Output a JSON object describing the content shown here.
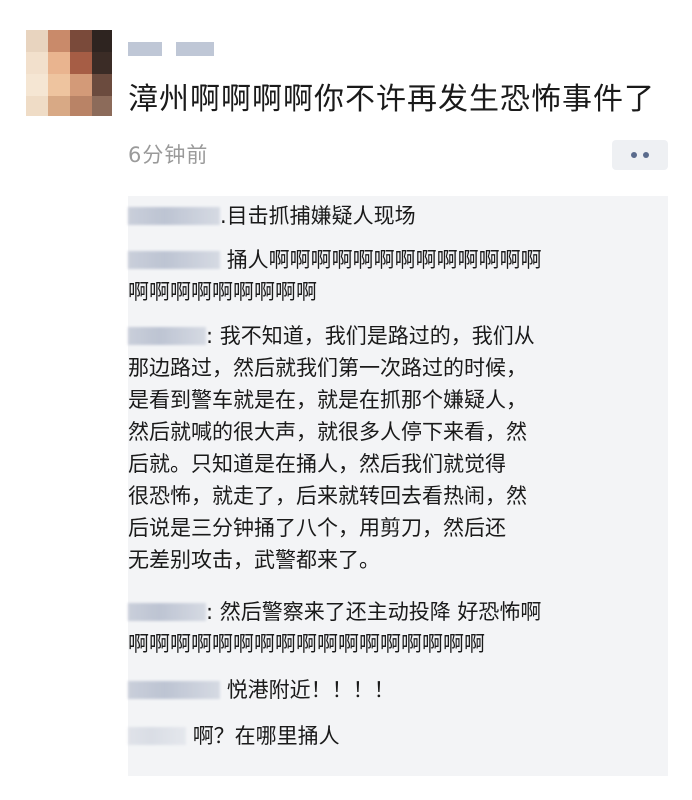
{
  "post": {
    "text": "漳州啊啊啊啊你不许再发生恐怖事件了",
    "time": "6分钟前"
  },
  "comments": [
    {
      "lines": [
        ".目击抓捕嫌疑人现场"
      ]
    },
    {
      "lines": [
        "捅人啊啊啊啊啊啊啊啊啊啊啊啊啊",
        "啊啊啊啊啊啊啊啊啊"
      ]
    },
    {
      "lines": [
        ": 我不知道，我们是路过的，我们从",
        "那边路过，然后就我们第一次路过的时候，",
        "是看到警车就是在，就是在抓那个嫌疑人，",
        "然后就喊的很大声，就很多人停下来看，然",
        "后就。只知道是在捅人，然后我们就觉得",
        "很恐怖，就走了，后来就转回去看热闹，然",
        "后说是三分钟捅了八个，用剪刀，然后还",
        "无差别攻击，武警都来了。"
      ]
    },
    {
      "lines": [
        ": 然后警察来了还主动投降 好恐怖啊",
        "啊啊啊啊啊啊啊啊啊啊啊啊啊啊啊啊啊"
      ]
    },
    {
      "lines": [
        "悦港附近！！！！"
      ]
    },
    {
      "lines": [
        "啊？在哪里捅人"
      ]
    }
  ]
}
